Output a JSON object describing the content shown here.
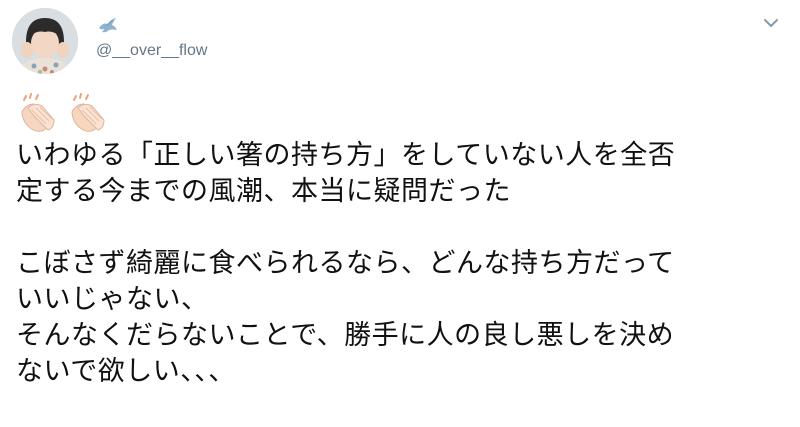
{
  "tweet": {
    "display_name_icon": "dove-icon",
    "handle": "@__over__flow",
    "menu_icon": "chevron-down-icon",
    "emoji": [
      "clapping-hands",
      "clapping-hands"
    ],
    "lines": [
      "いわゆる「正しい箸の持ち方」をしていない人を全否",
      "定する今までの風潮、本当に疑問だった",
      "",
      "こぼさず綺麗に食べられるなら、どんな持ち方だって",
      "いいじゃない、",
      "そんなくだらないことで、勝手に人の良し悪しを決め",
      "ないで欲しい、、、"
    ]
  }
}
